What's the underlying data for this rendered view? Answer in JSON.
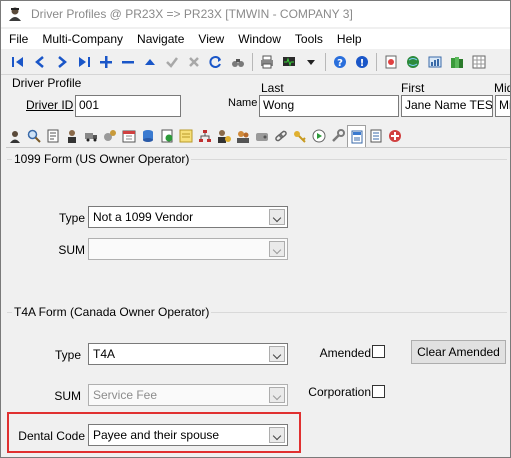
{
  "window": {
    "title": "Driver Profiles @ PR23X => PR23X [TMWIN - COMPANY 3]"
  },
  "menu": [
    "File",
    "Multi-Company",
    "Navigate",
    "View",
    "Window",
    "Tools",
    "Help"
  ],
  "header": {
    "section_title": "Driver Profile",
    "driver_id_label": "Driver ID",
    "driver_id_value": "001",
    "name_label": "Name",
    "last_label": "Last",
    "last_value": "Wong",
    "first_label": "First",
    "first_value": "Jane Name TESTi",
    "middle_label": "Mid",
    "middle_value": "Mi"
  },
  "form1099": {
    "title": "1099 Form (US Owner Operator)",
    "type_label": "Type",
    "type_value": "Not a 1099 Vendor",
    "sum_label": "SUM",
    "sum_value": ""
  },
  "t4a": {
    "title": "T4A Form (Canada Owner Operator)",
    "type_label": "Type",
    "type_value": "T4A",
    "sum_label": "SUM",
    "sum_value": "Service Fee",
    "amended_label": "Amended",
    "amended_checked": false,
    "clear_amended_label": "Clear Amended",
    "corporation_label": "Corporation",
    "corporation_checked": false
  },
  "dental": {
    "label": "Dental Code",
    "value": "Payee and their spouse"
  },
  "colors": {
    "highlight": "#e03030",
    "nav_blue": "#1a56c8"
  }
}
